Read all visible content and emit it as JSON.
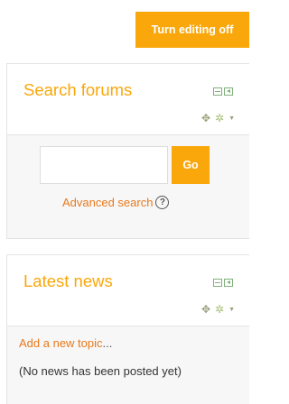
{
  "toolbar": {
    "edit_label": "Turn editing off"
  },
  "search_block": {
    "title": "Search forums",
    "input_value": "",
    "go_label": "Go",
    "advanced_label": "Advanced search",
    "help_glyph": "?"
  },
  "news_block": {
    "title": "Latest news",
    "add_link": "Add a new topic",
    "add_suffix": "...",
    "empty_text": "(No news has been posted yet)"
  },
  "icons": {
    "move": "move-icon",
    "settings": "gear-icon",
    "dock": "dock-icon"
  },
  "colors": {
    "accent": "#f9a70b",
    "link": "#e8791c",
    "dock_green": "#7fb07a"
  }
}
